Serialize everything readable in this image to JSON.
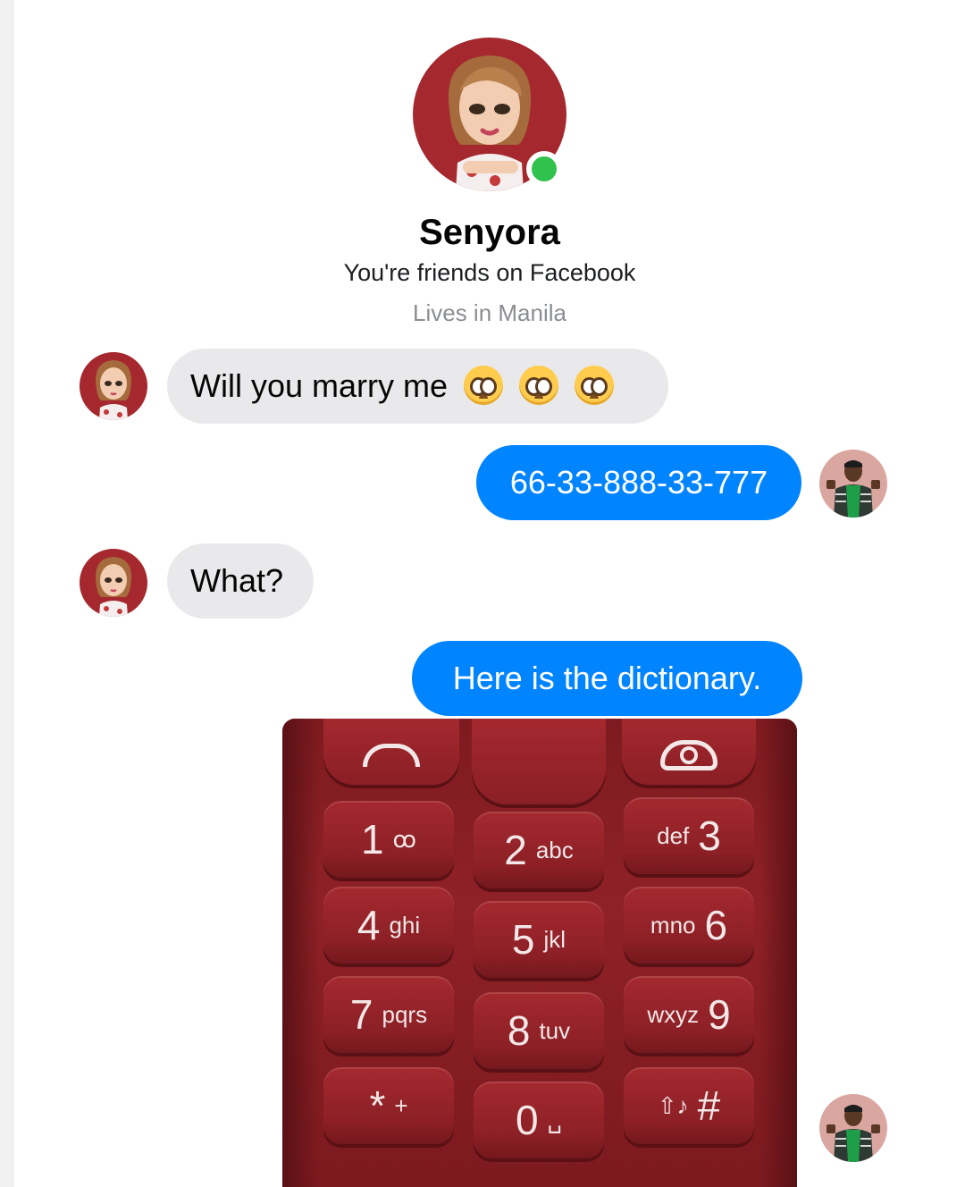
{
  "profile": {
    "name": "Senyora",
    "friends_line": "You're friends on Facebook",
    "location": "Lives in Manila"
  },
  "messages": [
    {
      "sender": "them",
      "text": "Will you marry me",
      "emoji": [
        "pleading-face-emoji",
        "pleading-face-emoji",
        "pleading-face-emoji"
      ]
    },
    {
      "sender": "me",
      "text": "66-33-888-33-777"
    },
    {
      "sender": "them",
      "text": "What?"
    },
    {
      "sender": "me",
      "text": "Here is the dictionary."
    }
  ],
  "keypad": {
    "keys": [
      {
        "num": "1",
        "letters": "ꝏ"
      },
      {
        "num": "2",
        "letters": "abc"
      },
      {
        "num": "3",
        "letters": "def"
      },
      {
        "num": "4",
        "letters": "ghi"
      },
      {
        "num": "5",
        "letters": "jkl"
      },
      {
        "num": "6",
        "letters": "mno"
      },
      {
        "num": "7",
        "letters": "pqrs"
      },
      {
        "num": "8",
        "letters": "tuv"
      },
      {
        "num": "9",
        "letters": "wxyz"
      },
      {
        "num": "*",
        "letters": "+"
      },
      {
        "num": "0",
        "letters": "␣"
      },
      {
        "num": "#",
        "letters": "⇧♪"
      }
    ]
  },
  "colors": {
    "outgoing_bubble": "#0084ff",
    "incoming_bubble": "#e9e9eb",
    "online_status": "#31c24d",
    "keypad_red": "#8e2127"
  }
}
